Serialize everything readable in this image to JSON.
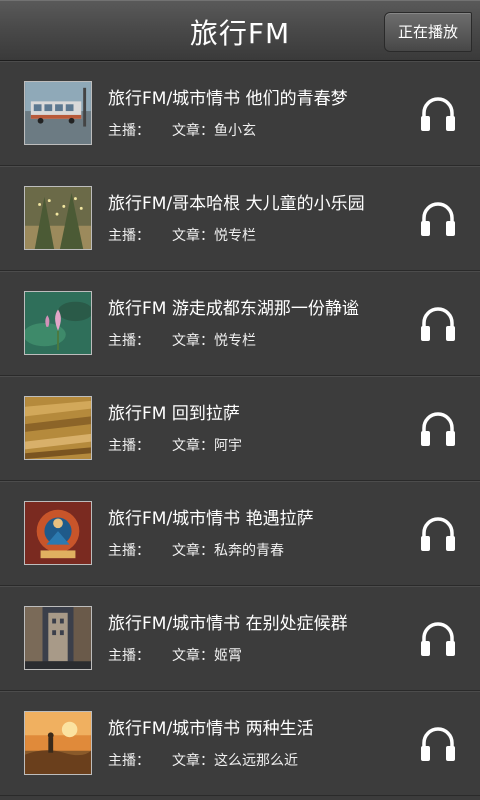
{
  "header": {
    "title": "旅行FM",
    "now_playing_label": "正在播放"
  },
  "list": {
    "host_label": "主播：",
    "article_label": "文章：",
    "items": [
      {
        "title": "旅行FM/城市情书 他们的青春梦",
        "author": "鱼小玄",
        "thumb": "city-bus"
      },
      {
        "title": "旅行FM/哥本哈根 大儿童的小乐园",
        "author": "悦专栏",
        "thumb": "park-lights"
      },
      {
        "title": "旅行FM 游走成都东湖那一份静谧",
        "author": "悦专栏",
        "thumb": "lotus"
      },
      {
        "title": "旅行FM 回到拉萨",
        "author": "阿宇",
        "thumb": "prayer-texture"
      },
      {
        "title": "旅行FM/城市情书 艳遇拉萨",
        "author": "私奔的青春",
        "thumb": "thangka"
      },
      {
        "title": "旅行FM/城市情书 在别处症候群",
        "author": "姬霄",
        "thumb": "street-view"
      },
      {
        "title": "旅行FM/城市情书 两种生活",
        "author": "这么远那么近",
        "thumb": "sunset-painting"
      }
    ]
  },
  "colors": {
    "background": "#3c3c3c",
    "text": "#ffffff",
    "headphone": "#ffffff"
  }
}
